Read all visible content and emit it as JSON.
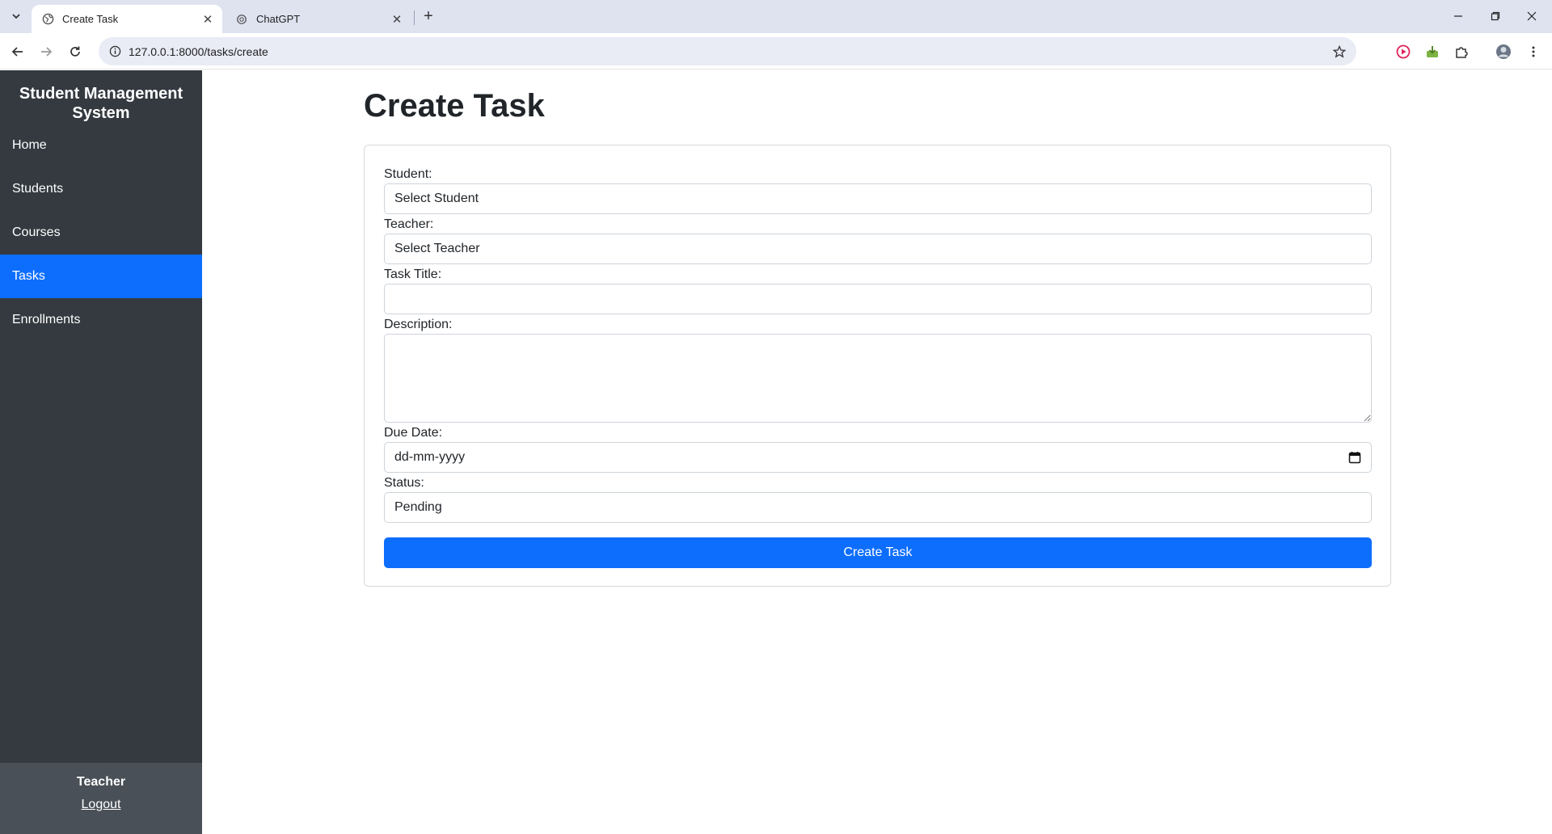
{
  "browser": {
    "tabs": [
      {
        "title": "Create Task",
        "active": true,
        "icon": "globe-icon"
      },
      {
        "title": "ChatGPT",
        "active": false,
        "icon": "openai-icon"
      }
    ],
    "url": "127.0.0.1:8000/tasks/create"
  },
  "sidebar": {
    "brand": "Student Management System",
    "items": [
      {
        "label": "Home",
        "active": false
      },
      {
        "label": "Students",
        "active": false
      },
      {
        "label": "Courses",
        "active": false
      },
      {
        "label": "Tasks",
        "active": true
      },
      {
        "label": "Enrollments",
        "active": false
      }
    ],
    "footer": {
      "role": "Teacher",
      "logout_label": "Logout"
    }
  },
  "page": {
    "title": "Create Task",
    "form": {
      "student_label": "Student:",
      "student_value": "Select Student",
      "teacher_label": "Teacher:",
      "teacher_value": "Select Teacher",
      "task_title_label": "Task Title:",
      "task_title_value": "",
      "description_label": "Description:",
      "description_value": "",
      "due_date_label": "Due Date:",
      "due_date_placeholder": "dd-mm-yyyy",
      "status_label": "Status:",
      "status_value": "Pending",
      "submit_label": "Create Task"
    }
  },
  "colors": {
    "sidebar_bg": "#343a40",
    "sidebar_footer_bg": "#495057",
    "accent": "#0d6efd"
  }
}
